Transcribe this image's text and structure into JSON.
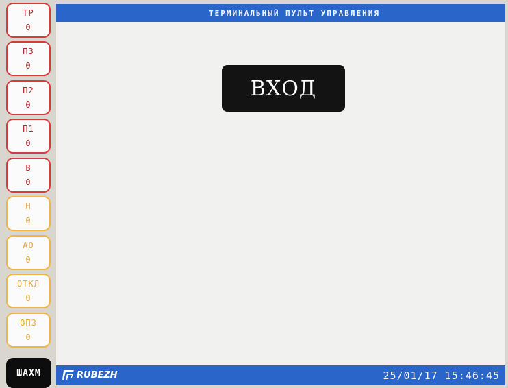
{
  "header": {
    "title": "ТЕРМИНАЛЬНЫЙ ПУЛЬТ УПРАВЛЕНИЯ"
  },
  "counters": [
    {
      "label": "ТР",
      "value": "0",
      "color": "#d93a3a"
    },
    {
      "label": "П3",
      "value": "0",
      "color": "#d93a3a"
    },
    {
      "label": "П2",
      "value": "0",
      "color": "#d93a3a"
    },
    {
      "label": "П1",
      "value": "0",
      "color": "#d93a3a"
    },
    {
      "label": "В",
      "value": "0",
      "color": "#d93a3a"
    },
    {
      "label": "Н",
      "value": "0",
      "color": "#f1b545"
    },
    {
      "label": "АО",
      "value": "0",
      "color": "#f1b545"
    },
    {
      "label": "ОТКЛ",
      "value": "0",
      "color": "#f1b545"
    },
    {
      "label": "ОПЗ",
      "value": "0",
      "color": "#f1b545"
    }
  ],
  "sidebar_button": {
    "label": "ШАХМ"
  },
  "main": {
    "login_label": "ВХОД"
  },
  "footer": {
    "brand": "RUBEZH",
    "datetime": "25/01/17 15:46:45"
  },
  "colors": {
    "accent": "#2a66c9",
    "alarm": "#d93a3a",
    "warning": "#f1b545"
  }
}
